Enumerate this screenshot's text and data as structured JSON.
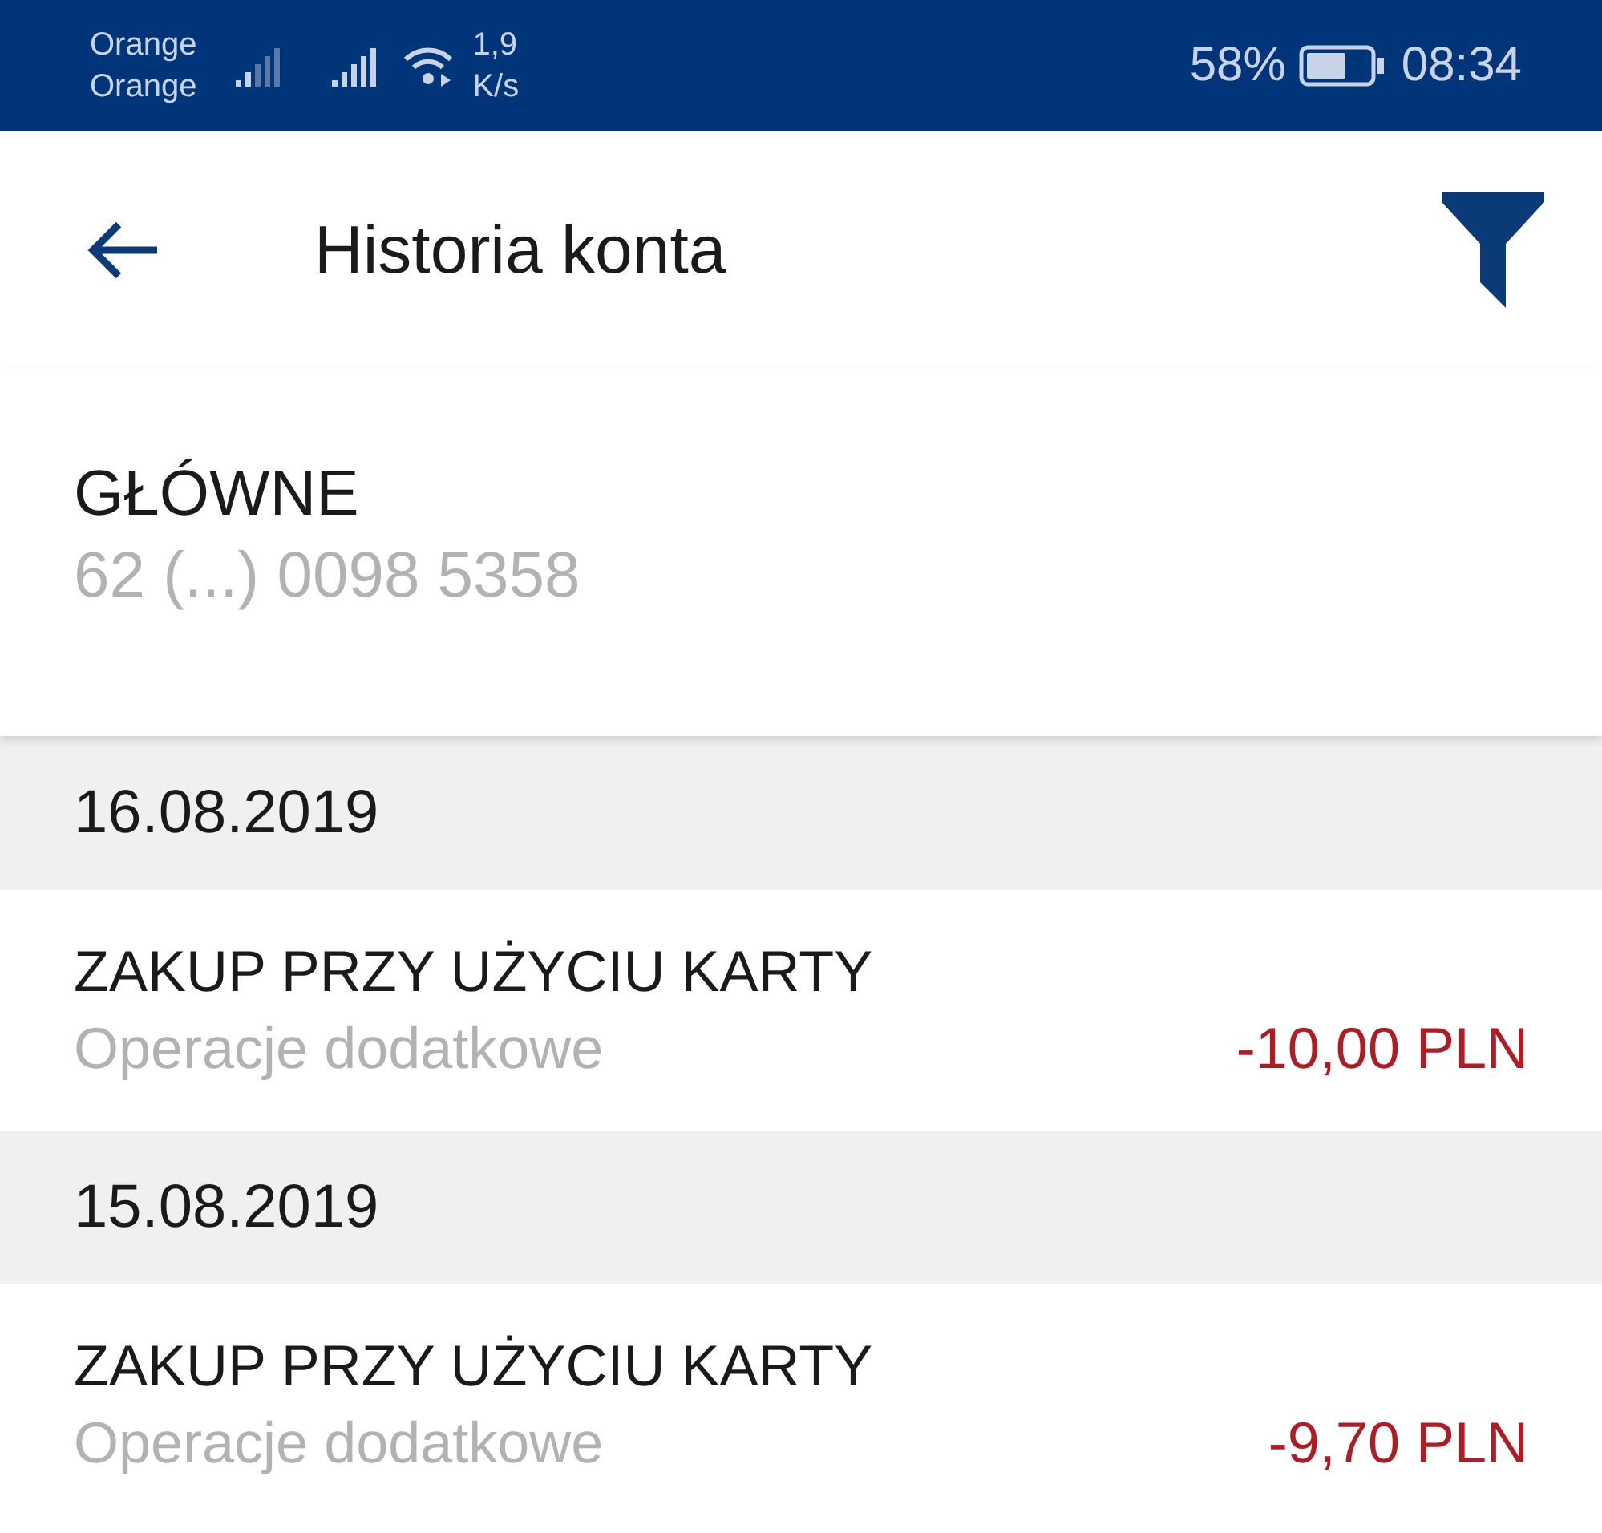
{
  "status_bar": {
    "carriers": [
      "Orange",
      "Orange"
    ],
    "speed": [
      "1,9",
      "K/s"
    ],
    "battery": "58%",
    "time": "08:34"
  },
  "header": {
    "title": "Historia konta"
  },
  "account": {
    "name": "GŁÓWNE",
    "number": "62 (...) 0098 5358"
  },
  "groups": [
    {
      "date": "16.08.2019",
      "transactions": [
        {
          "title": "ZAKUP PRZY UŻYCIU KARTY",
          "category": "Operacje dodatkowe",
          "amount": "-10,00 PLN"
        }
      ]
    },
    {
      "date": "15.08.2019",
      "transactions": [
        {
          "title": "ZAKUP PRZY UŻYCIU KARTY",
          "category": "Operacje dodatkowe",
          "amount": "-9,70 PLN"
        }
      ]
    }
  ]
}
